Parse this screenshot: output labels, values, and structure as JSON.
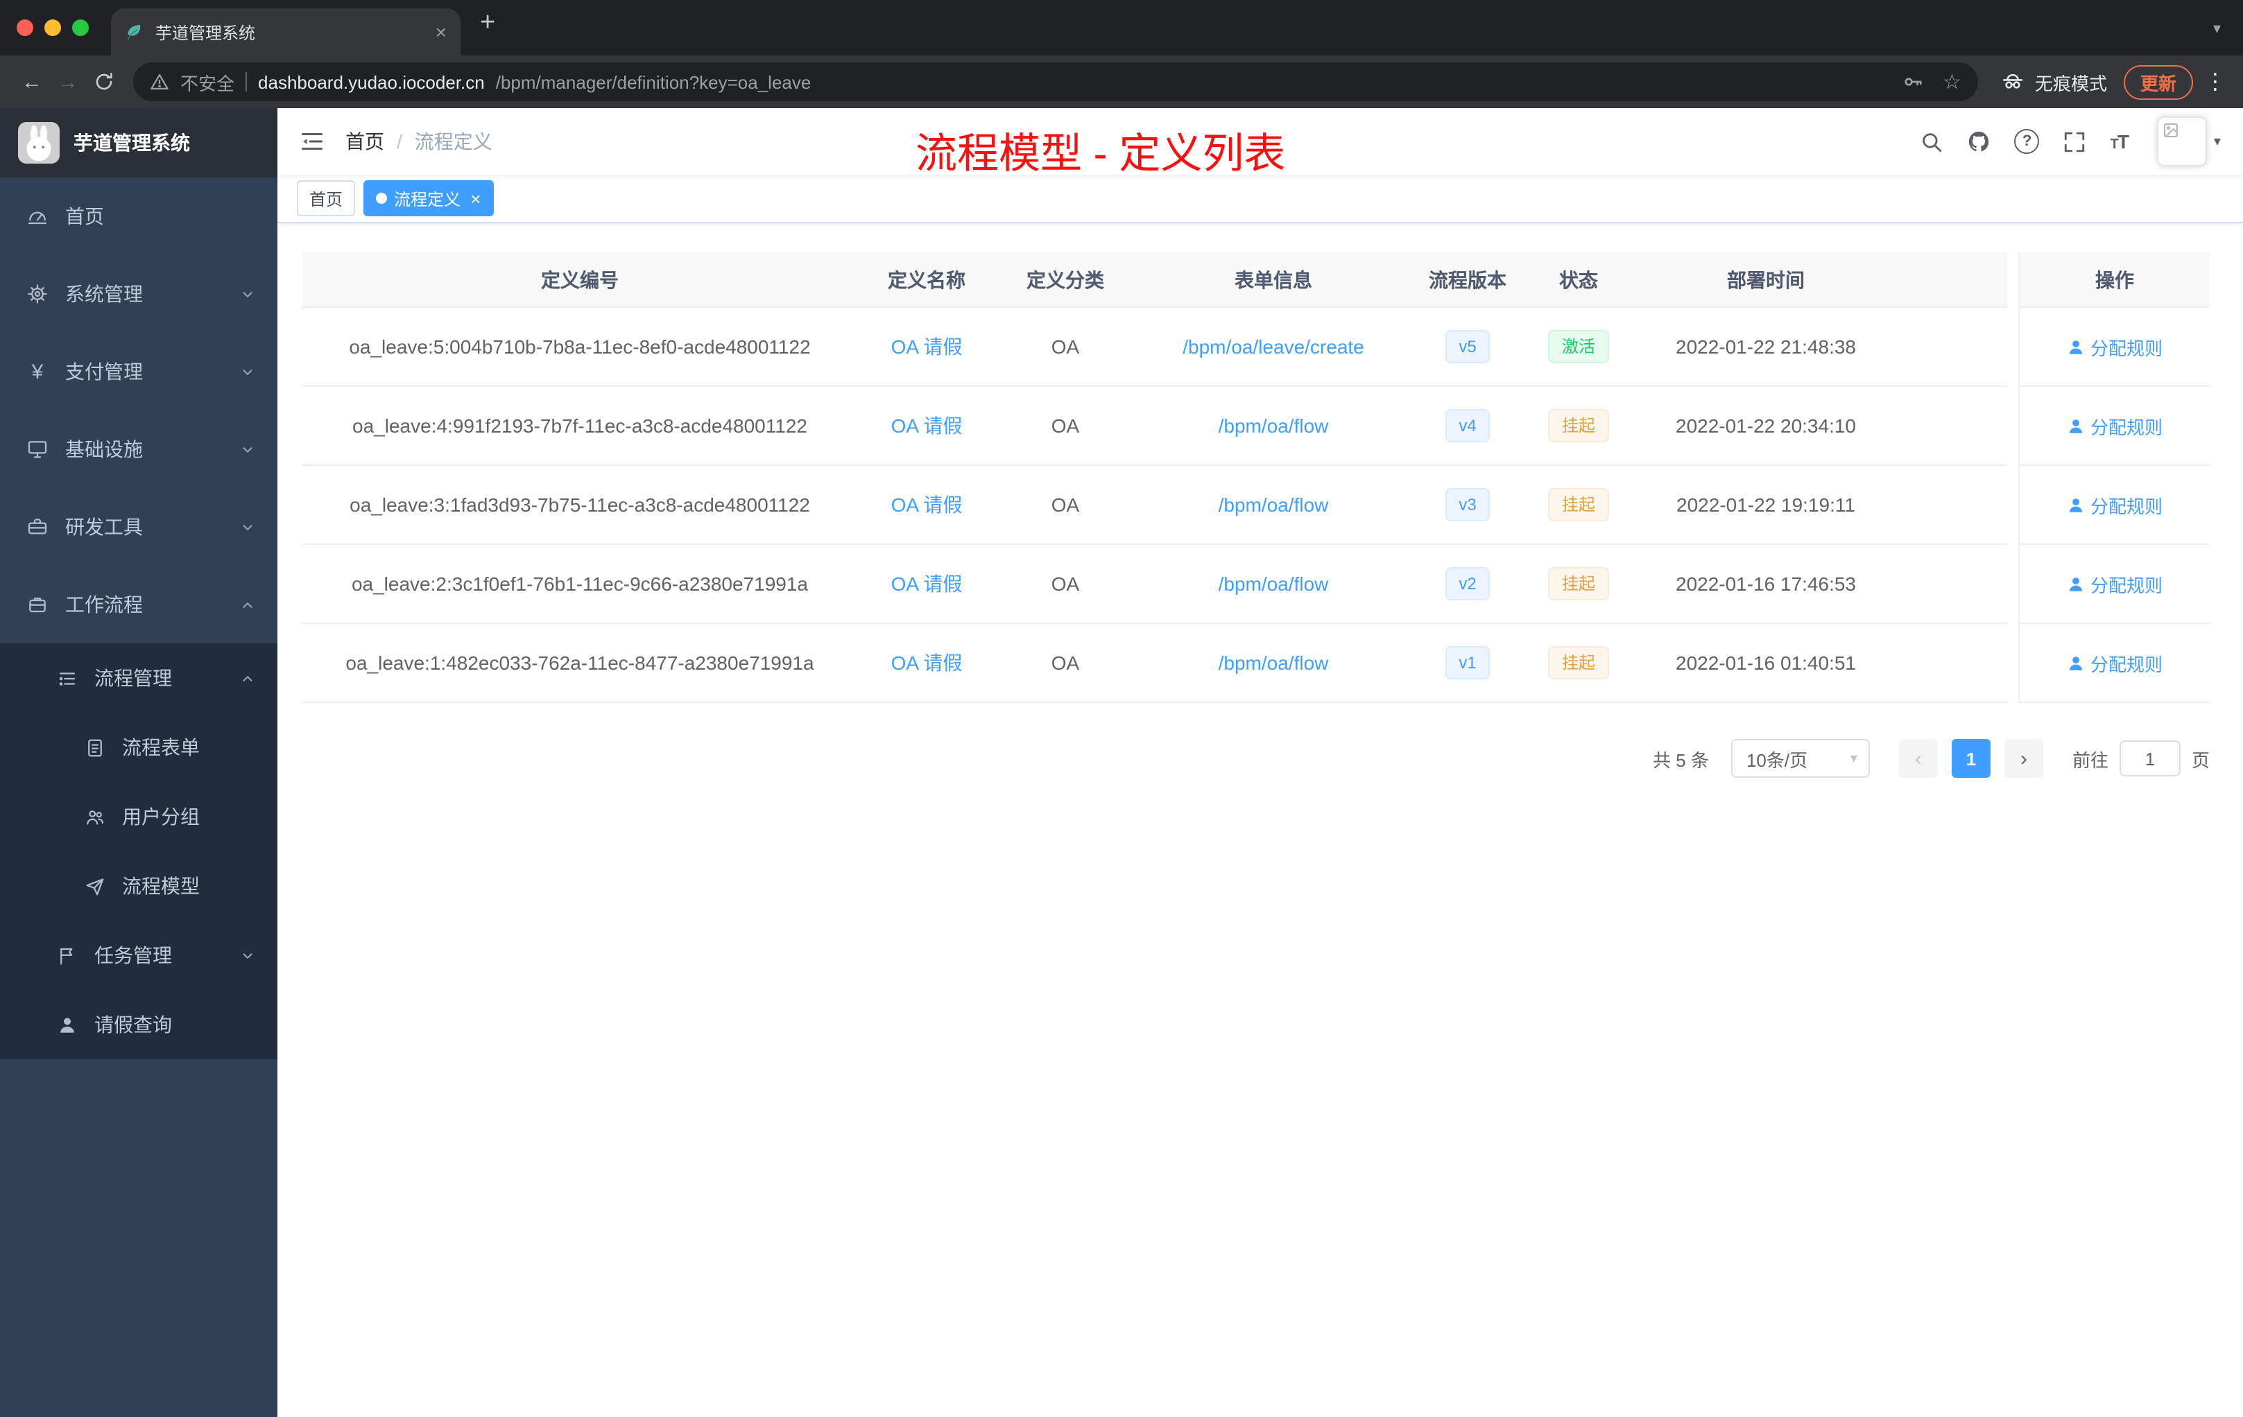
{
  "browser": {
    "tab_title": "芋道管理系统",
    "security_label": "不安全",
    "url_host": "dashboard.yudao.iocoder.cn",
    "url_path": "/bpm/manager/definition?key=oa_leave",
    "incognito_label": "无痕模式",
    "update_label": "更新"
  },
  "icons": {
    "close": "×",
    "plus": "+",
    "caret_down": "▾",
    "dots_vertical": "⋮",
    "back": "←",
    "forward": "→",
    "star": "☆",
    "prev": "‹",
    "next": "›",
    "question": "?",
    "breadcrumb_separator": "/",
    "font_big": "T",
    "font_small": "T"
  },
  "sidebar": {
    "logo_title": "芋道管理系统",
    "items": [
      "首页",
      "系统管理",
      "支付管理",
      "基础设施",
      "研发工具",
      "工作流程"
    ],
    "sub_items": [
      "流程管理",
      "流程表单",
      "用户分组",
      "流程模型",
      "任务管理",
      "请假查询"
    ]
  },
  "header": {
    "breadcrumb_home": "首页",
    "breadcrumb_current": "流程定义",
    "annotation": "流程模型 - 定义列表"
  },
  "tags": {
    "home": "首页",
    "active": "流程定义"
  },
  "table": {
    "columns": [
      "定义编号",
      "定义名称",
      "定义分类",
      "表单信息",
      "流程版本",
      "状态",
      "部署时间",
      "操作"
    ],
    "rows": [
      {
        "id": "oa_leave:5:004b710b-7b8a-11ec-8ef0-acde48001122",
        "name": "OA 请假",
        "category": "OA",
        "form": "/bpm/oa/leave/create",
        "version": "v5",
        "status": "激活",
        "status_type": "success",
        "time": "2022-01-22 21:48:38",
        "action": "分配规则"
      },
      {
        "id": "oa_leave:4:991f2193-7b7f-11ec-a3c8-acde48001122",
        "name": "OA 请假",
        "category": "OA",
        "form": "/bpm/oa/flow",
        "version": "v4",
        "status": "挂起",
        "status_type": "warning",
        "time": "2022-01-22 20:34:10",
        "action": "分配规则"
      },
      {
        "id": "oa_leave:3:1fad3d93-7b75-11ec-a3c8-acde48001122",
        "name": "OA 请假",
        "category": "OA",
        "form": "/bpm/oa/flow",
        "version": "v3",
        "status": "挂起",
        "status_type": "warning",
        "time": "2022-01-22 19:19:11",
        "action": "分配规则"
      },
      {
        "id": "oa_leave:2:3c1f0ef1-76b1-11ec-9c66-a2380e71991a",
        "name": "OA 请假",
        "category": "OA",
        "form": "/bpm/oa/flow",
        "version": "v2",
        "status": "挂起",
        "status_type": "warning",
        "time": "2022-01-16 17:46:53",
        "action": "分配规则"
      },
      {
        "id": "oa_leave:1:482ec033-762a-11ec-8477-a2380e71991a",
        "name": "OA 请假",
        "category": "OA",
        "form": "/bpm/oa/flow",
        "version": "v1",
        "status": "挂起",
        "status_type": "warning",
        "time": "2022-01-16 01:40:51",
        "action": "分配规则"
      }
    ]
  },
  "pagination": {
    "total": "共 5 条",
    "page_size": "10条/页",
    "current_page": "1",
    "goto_label": "前往",
    "goto_value": "1",
    "page_unit": "页"
  }
}
